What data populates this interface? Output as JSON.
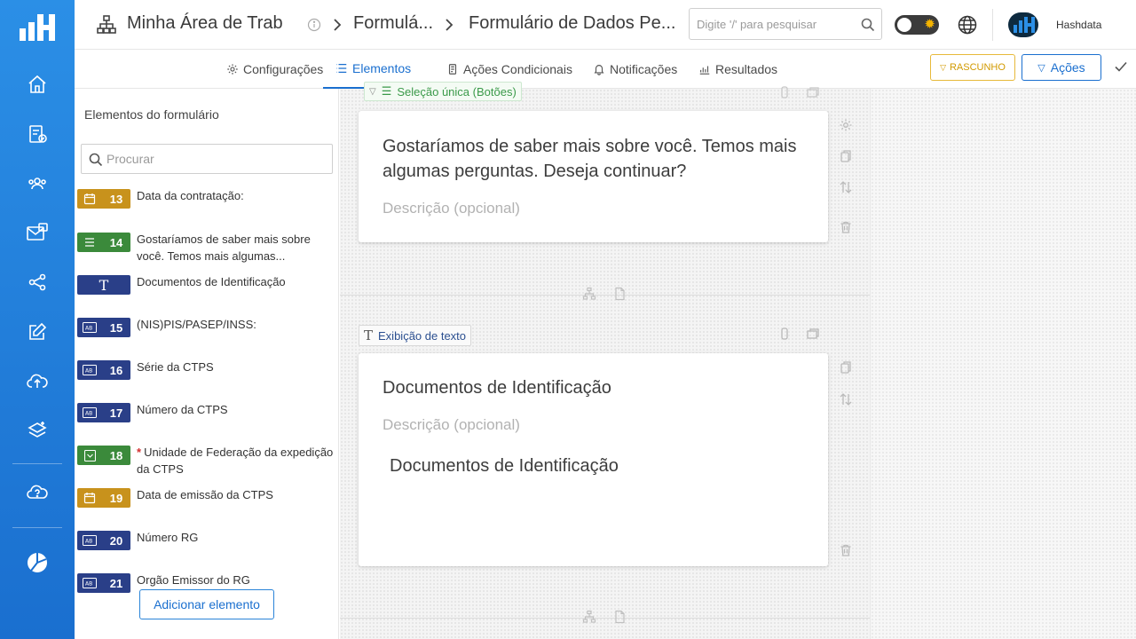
{
  "header": {
    "crumbs": [
      "Minha Área de Trab",
      "Formulá...",
      "Formulário de Dados Pe..."
    ],
    "search_placeholder": "Digite '/' para pesquisar",
    "user_name": "Hashdata"
  },
  "tabs": [
    {
      "label": "Configurações",
      "icon": "gear-icon"
    },
    {
      "label": "Elementos",
      "icon": "list-icon"
    },
    {
      "label": "Ações Condicionais",
      "icon": "clipboard-icon"
    },
    {
      "label": "Notificações",
      "icon": "bell-icon"
    },
    {
      "label": "Resultados",
      "icon": "chart-icon"
    }
  ],
  "toolbar": {
    "draft_label": "RASCUNHO",
    "actions_label": "Ações"
  },
  "panel": {
    "title": "Elementos do formulário",
    "search_placeholder": "Procurar",
    "add_button": "Adicionar elemento",
    "items": [
      {
        "num": "13",
        "type": "date",
        "color": "#c8921c",
        "text": "Data da contratação:",
        "required": false
      },
      {
        "num": "14",
        "type": "list",
        "color": "#3b8a3b",
        "text": "Gostaríamos de saber mais sobre você. Temos mais algumas...",
        "required": false
      },
      {
        "num": "",
        "type": "text",
        "color": "#2a3f88",
        "text": "Documentos de Identificação",
        "required": false
      },
      {
        "num": "15",
        "type": "ab",
        "color": "#2a3f88",
        "text": "(NIS)PIS/PASEP/INSS:",
        "required": false
      },
      {
        "num": "16",
        "type": "ab",
        "color": "#2a3f88",
        "text": "Série da CTPS",
        "required": false
      },
      {
        "num": "17",
        "type": "ab",
        "color": "#2a3f88",
        "text": "Número da CTPS",
        "required": false
      },
      {
        "num": "18",
        "type": "select",
        "color": "#3b8a3b",
        "text": "Unidade de Federação da expedição da CTPS",
        "required": true
      },
      {
        "num": "19",
        "type": "date",
        "color": "#c8921c",
        "text": "Data de emissão da CTPS",
        "required": false
      },
      {
        "num": "20",
        "type": "ab",
        "color": "#2a3f88",
        "text": "Número RG",
        "required": false
      },
      {
        "num": "21",
        "type": "ab",
        "color": "#2a3f88",
        "text": "Orgão Emissor do RG",
        "required": false
      }
    ]
  },
  "canvas": {
    "top_tag": "Seleção única (Botões)",
    "card1": {
      "question": "Gostaríamos de saber mais sobre você. Temos mais algumas perguntas. Deseja continuar?",
      "description_placeholder": "Descrição (opcional)"
    },
    "text_tag": "Exibição de texto",
    "card2": {
      "title": "Documentos de Identificação",
      "description_placeholder": "Descrição (opcional)",
      "body": "Documentos de Identificação"
    }
  }
}
